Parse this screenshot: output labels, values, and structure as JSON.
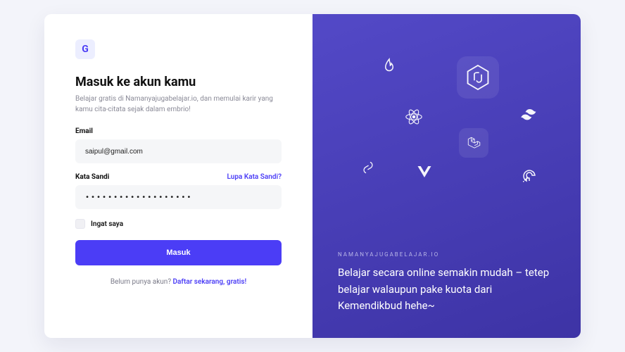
{
  "logo_letter": "G",
  "title": "Masuk ke akun kamu",
  "subtitle": "Belajar gratis di Namanyajugabelajar.io, dan memulai karir yang kamu cita-citata sejak dalam embrio!",
  "email": {
    "label": "Email",
    "value": "saipul@gmail.com"
  },
  "password": {
    "label": "Kata Sandi",
    "forgot": "Lupa Kata Sandi?",
    "value": "•••••••••••••••••••"
  },
  "remember_label": "Ingat saya",
  "submit_label": "Masuk",
  "footer_plain": "Belum punya akun? ",
  "footer_link": "Daftar sekarang, gratis!",
  "right": {
    "eyebrow": "NAMANYAJUGABELAJAR.IO",
    "hero": "Belajar secara online semakin mudah – tetep belajar walaupun pake kuota dari Kemendikbud hehe~"
  },
  "icons": {
    "flame": "flame-icon",
    "react": "react-icon",
    "nodejs": "nodejs-icon",
    "tailwind": "tailwind-icon",
    "laravel": "laravel-icon",
    "svelte": "svelte-icon",
    "vue": "vue-icon",
    "digitalocean": "digitalocean-icon"
  }
}
